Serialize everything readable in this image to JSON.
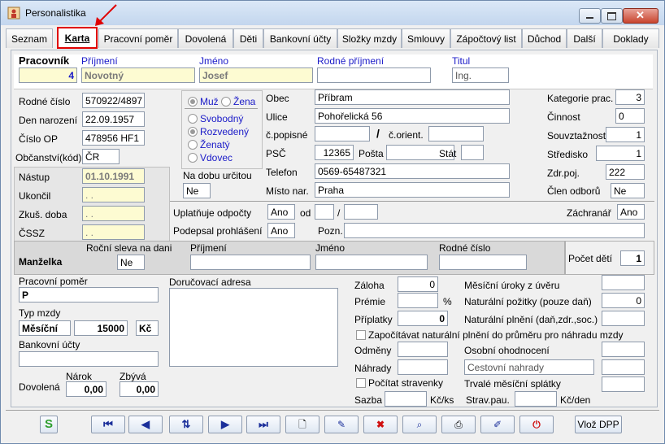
{
  "window": {
    "title": "Personalistika"
  },
  "tabs": [
    {
      "label": "Seznam",
      "active": false
    },
    {
      "label": "Karta",
      "active": true
    },
    {
      "label": "Pracovní poměr",
      "active": false
    },
    {
      "label": "Dovolená",
      "active": false
    },
    {
      "label": "Děti",
      "active": false
    },
    {
      "label": "Bankovní účty",
      "active": false
    },
    {
      "label": "Složky mzdy",
      "active": false
    },
    {
      "label": "Smlouvy",
      "active": false
    },
    {
      "label": "Zápočtový list",
      "active": false
    },
    {
      "label": "Důchod",
      "active": false
    },
    {
      "label": "Další",
      "active": false
    },
    {
      "label": "Doklady",
      "active": false
    }
  ],
  "header": {
    "pracovnik_label": "Pracovník",
    "pracovnik_value": "4",
    "prijmeni_label": "Příjmení",
    "prijmeni_value": "Novotný",
    "jmeno_label": "Jméno",
    "jmeno_value": "Josef",
    "rodne_prijmeni_label": "Rodné příjmení",
    "rodne_prijmeni_value": "",
    "titul_label": "Titul",
    "titul_value": "Ing."
  },
  "personal": {
    "rodne_cislo_label": "Rodné číslo",
    "rodne_cislo": "570922/4897",
    "den_narozeni_label": "Den narození",
    "den_narozeni": "22.09.1957",
    "cislo_op_label": "Číslo OP",
    "cislo_op": "478956 HF1",
    "obcanstvi_label": "Občanství(kód)",
    "obcanstvi": "ČR"
  },
  "gender": {
    "muz": "Muž",
    "zena": "Žena",
    "selected": "muz"
  },
  "marital": {
    "options": [
      "Svobodný",
      "Rozvedený",
      "Ženatý",
      "Vdovec"
    ]
  },
  "address": {
    "obec_label": "Obec",
    "obec": "Příbram",
    "ulice_label": "Ulice",
    "ulice": "Pohořelická 56",
    "cpopisne_label": "č.popisné",
    "cpopisne": "",
    "slash": "/",
    "corient_label": "č.orient.",
    "corient": "",
    "psc_label": "PSČ",
    "psc": "12365",
    "posta_label": "Pošta",
    "posta": "",
    "stat_label": "Stát",
    "stat": "",
    "telefon_label": "Telefon",
    "telefon": "0569-65487321",
    "misto_label": "Místo nar.",
    "misto": "Praha"
  },
  "work": {
    "kategorie_label": "Kategorie prac.",
    "kategorie": "3",
    "cinnost_label": "Činnost",
    "cinnost": "0",
    "souvztaznost_label": "Souvztažnost",
    "souvztaznost": "1",
    "stredisko_label": "Středisko",
    "stredisko": "1",
    "zdrpoj_label": "Zdr.poj.",
    "zdrpoj": "222",
    "clen_label": "Člen odborů",
    "clen": "Ne"
  },
  "dates": {
    "nastup_label": "Nástup",
    "nastup": "01.10.1991",
    "ukoncil_label": "Ukončil",
    "ukoncil": ". .",
    "zkus_label": "Zkuš. doba",
    "zkus": ". .",
    "cssz_label": "ČSSZ",
    "cssz": ". ."
  },
  "misc": {
    "na_dobu_label": "Na dobu určitou",
    "na_dobu": "Ne",
    "uplatnuje_label": "Uplatňuje odpočty",
    "uplatnuje": "Ano",
    "od_label": "od",
    "od1": "",
    "od2": "",
    "od_slash": "/",
    "zachranar_label": "Záchranář",
    "zachranar": "Ano",
    "podepsal_label": "Podepsal prohlášení",
    "podepsal": "Ano",
    "pozn_label": "Pozn.",
    "pozn": ""
  },
  "spouse": {
    "label": "Manželka",
    "sleva_label": "Roční sleva na dani",
    "sleva": "Ne",
    "prijmeni_label": "Příjmení",
    "prijmeni": "",
    "jmeno_label": "Jméno",
    "jmeno": "",
    "rc_label": "Rodné číslo",
    "rc": "",
    "pocet_deti_label": "Počet dětí",
    "pocet_deti": "1"
  },
  "bottom": {
    "pp_label": "Pracovní poměr",
    "pp": "P",
    "typ_label": "Typ mzdy",
    "typ": "Měsíční",
    "castka": "15000",
    "mena": "Kč",
    "bu_label": "Bankovní účty",
    "bu": "",
    "dovolena_label": "Dovolená",
    "narok_label": "Nárok",
    "narok": "0,00",
    "zbyva_label": "Zbývá",
    "zbyva": "0,00",
    "dorucovaci_label": "Doručovací adresa",
    "dorucovaci": ""
  },
  "pay": {
    "zaloha_label": "Záloha",
    "zaloha": "0",
    "premie_label": "Prémie",
    "premie": "",
    "pct": "%",
    "priplatky_label": "Příplatky",
    "priplatky": "0",
    "zapocitavat_label": "Započítávat naturální plnění do průměru pro náhradu mzdy",
    "odmeny_label": "Odměny",
    "odmeny": "",
    "nahrady_label": "Náhrady",
    "nahrady": "",
    "pocitat_label": "Počítat stravenky",
    "sazba_label": "Sazba",
    "sazba": "",
    "kcks": "Kč/ks",
    "mesicni_uroky_label": "Měsíční úroky z úvěru",
    "mesicni_uroky": "",
    "nat_pozitky_label": "Naturální požitky (pouze daň)",
    "nat_pozitky": "0",
    "nat_plneni_label": "Naturální plnění (daň,zdr.,soc.)",
    "nat_plneni": "",
    "osobni_label": "Osobní ohodnocení",
    "osobni": "",
    "cestovni": "Cestovní nahrady",
    "cestovni_val": "",
    "trvale_label": "Trvalé měsíční splátky",
    "trvale": "",
    "strav_label": "Strav.pau.",
    "strav": "",
    "kcden": "Kč/den"
  },
  "toolbar": {
    "vloz_dpp": "Vlož DPP"
  },
  "colors": {
    "accent_red": "#e00000",
    "field_yellow": "#fdfbd2",
    "label_blue": "#1a1ac8"
  }
}
